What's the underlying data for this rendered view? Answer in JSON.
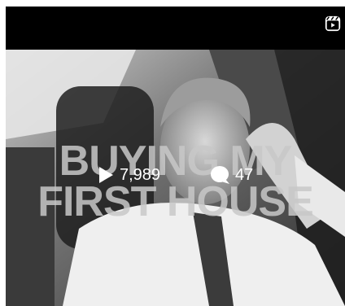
{
  "post": {
    "title_line1": "BUYING MY",
    "title_line2": "FIRST HOUSE",
    "views": "7,989",
    "comments": "47",
    "type_icon": "reels-icon"
  },
  "icons": {
    "views": "play-icon",
    "comments": "comment-bubble-icon"
  },
  "colors": {
    "topbar": "#000000",
    "stat_text": "#ffffff"
  }
}
